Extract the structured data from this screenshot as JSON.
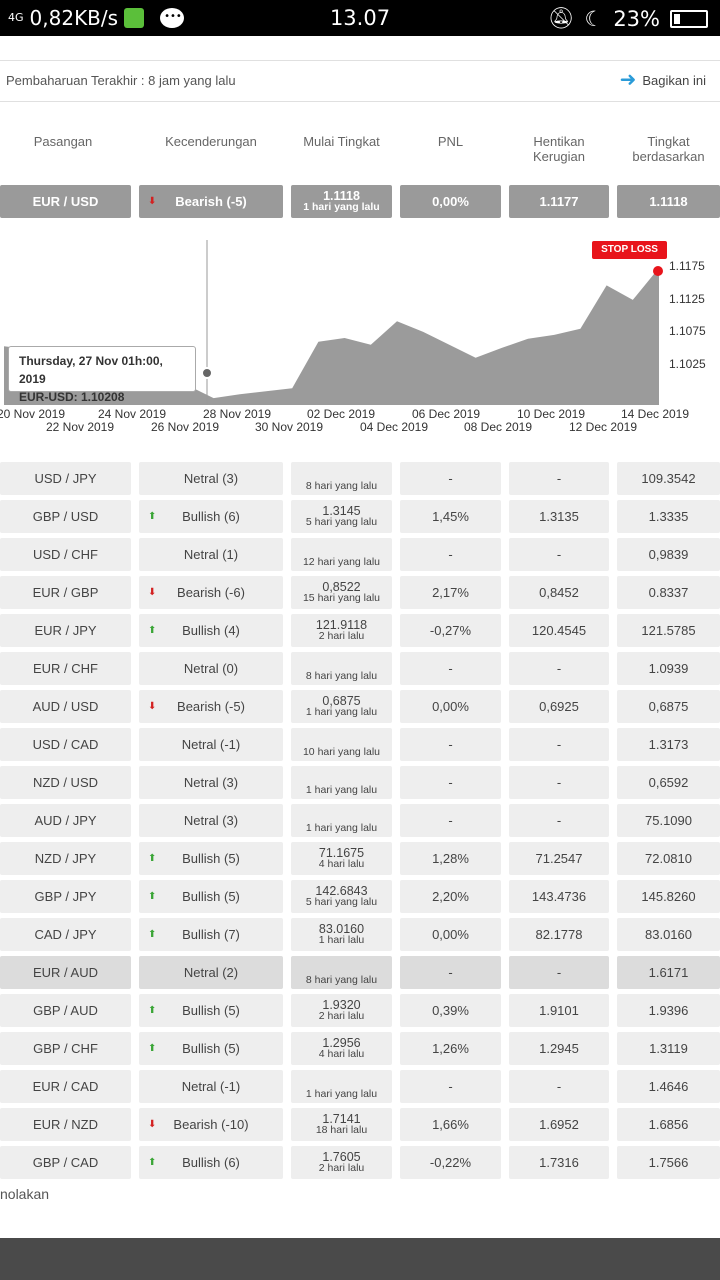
{
  "status": {
    "network": "0,82KB/s",
    "signal": "4G",
    "time": "13.07",
    "battery": "23%"
  },
  "header": {
    "updated": "Pembaharuan Terakhir : 8 jam yang lalu",
    "share": "Bagikan ini"
  },
  "columns": {
    "pair": "Pasangan",
    "trend": "Kecenderungan",
    "start": "Mulai Tingkat",
    "pnl": "PNL",
    "stop": "Hentikan Kerugian",
    "rate": "Tingkat berdasarkan"
  },
  "selected": {
    "pair": "EUR / USD",
    "trend": "Bearish (-5)",
    "trend_dir": "down",
    "level": "1.1118",
    "ago": "1 hari yang lalu",
    "pnl": "0,00%",
    "stop": "1.1177",
    "rate": "1.1118"
  },
  "chart_data": {
    "type": "area",
    "title": "",
    "series": [
      {
        "name": "EUR-USD",
        "x": [
          "2019-11-20",
          "2019-11-21",
          "2019-11-22",
          "2019-11-23",
          "2019-11-25",
          "2019-11-26",
          "2019-11-27",
          "2019-11-28",
          "2019-11-29",
          "2019-12-01",
          "2019-12-02",
          "2019-12-03",
          "2019-12-04",
          "2019-12-05",
          "2019-12-06",
          "2019-12-08",
          "2019-12-09",
          "2019-12-10",
          "2019-12-11",
          "2019-12-12",
          "2019-12-13",
          "2019-12-14",
          "2019-12-15"
        ],
        "values": [
          1.1072,
          1.1068,
          1.1058,
          1.1024,
          1.1013,
          1.1018,
          1.1021,
          1.1004,
          1.1009,
          1.1017,
          1.1078,
          1.1083,
          1.1074,
          1.1105,
          1.1091,
          1.1057,
          1.107,
          1.1082,
          1.1087,
          1.1095,
          1.1152,
          1.1133,
          1.1175
        ]
      }
    ],
    "y_ticks": [
      "1.1175",
      "1.1125",
      "1.1075",
      "1.1025"
    ],
    "x_ticks_top": [
      "20 Nov 2019",
      "24 Nov 2019",
      "28 Nov 2019",
      "02 Dec 2019",
      "06 Dec 2019",
      "10 Dec 2019",
      "14 Dec 2019"
    ],
    "x_ticks_bottom": [
      "22 Nov 2019",
      "26 Nov 2019",
      "30 Nov 2019",
      "04 Dec 2019",
      "08 Dec 2019",
      "12 Dec 2019"
    ],
    "tooltip_date": "Thursday, 27 Nov 01h:00, 2019",
    "tooltip_value": "EUR-USD: 1.10208",
    "stop_loss_label": "STOP LOSS",
    "colors": {
      "area": "#9b9b9b",
      "stop": "#e8141b"
    }
  },
  "rows": [
    {
      "pair": "USD / JPY",
      "trend": "Netral (3)",
      "dir": "",
      "level": "",
      "ago": "8 hari yang lalu",
      "pnl": "-",
      "stop": "-",
      "rate": "109.3542"
    },
    {
      "pair": "GBP / USD",
      "trend": "Bullish (6)",
      "dir": "up",
      "level": "1.3145",
      "ago": "5 hari yang lalu",
      "pnl": "1,45%",
      "stop": "1.3135",
      "rate": "1.3335"
    },
    {
      "pair": "USD / CHF",
      "trend": "Netral (1)",
      "dir": "",
      "level": "",
      "ago": "12 hari yang lalu",
      "pnl": "-",
      "stop": "-",
      "rate": "0,9839"
    },
    {
      "pair": "EUR / GBP",
      "trend": "Bearish (-6)",
      "dir": "down",
      "level": "0,8522",
      "ago": "15 hari yang lalu",
      "pnl": "2,17%",
      "stop": "0,8452",
      "rate": "0.8337"
    },
    {
      "pair": "EUR / JPY",
      "trend": "Bullish (4)",
      "dir": "up",
      "level": "121.9118",
      "ago": "2 hari lalu",
      "pnl": "-0,27%",
      "stop": "120.4545",
      "rate": "121.5785"
    },
    {
      "pair": "EUR / CHF",
      "trend": "Netral (0)",
      "dir": "",
      "level": "",
      "ago": "8 hari yang lalu",
      "pnl": "-",
      "stop": "-",
      "rate": "1.0939"
    },
    {
      "pair": "AUD / USD",
      "trend": "Bearish (-5)",
      "dir": "down",
      "level": "0,6875",
      "ago": "1 hari yang lalu",
      "pnl": "0,00%",
      "stop": "0,6925",
      "rate": "0,6875"
    },
    {
      "pair": "USD / CAD",
      "trend": "Netral (-1)",
      "dir": "",
      "level": "",
      "ago": "10 hari yang lalu",
      "pnl": "-",
      "stop": "-",
      "rate": "1.3173"
    },
    {
      "pair": "NZD / USD",
      "trend": "Netral (3)",
      "dir": "",
      "level": "",
      "ago": "1 hari yang lalu",
      "pnl": "-",
      "stop": "-",
      "rate": "0,6592"
    },
    {
      "pair": "AUD / JPY",
      "trend": "Netral (3)",
      "dir": "",
      "level": "",
      "ago": "1 hari yang lalu",
      "pnl": "-",
      "stop": "-",
      "rate": "75.1090"
    },
    {
      "pair": "NZD / JPY",
      "trend": "Bullish (5)",
      "dir": "up",
      "level": "71.1675",
      "ago": "4 hari lalu",
      "pnl": "1,28%",
      "stop": "71.2547",
      "rate": "72.0810"
    },
    {
      "pair": "GBP / JPY",
      "trend": "Bullish (5)",
      "dir": "up",
      "level": "142.6843",
      "ago": "5 hari yang lalu",
      "pnl": "2,20%",
      "stop": "143.4736",
      "rate": "145.8260"
    },
    {
      "pair": "CAD / JPY",
      "trend": "Bullish (7)",
      "dir": "up",
      "level": "83.0160",
      "ago": "1 hari lalu",
      "pnl": "0,00%",
      "stop": "82.1778",
      "rate": "83.0160"
    },
    {
      "pair": "EUR / AUD",
      "trend": "Netral (2)",
      "dir": "",
      "level": "",
      "ago": "8 hari yang lalu",
      "pnl": "-",
      "stop": "-",
      "rate": "1.6171",
      "hl": true
    },
    {
      "pair": "GBP / AUD",
      "trend": "Bullish (5)",
      "dir": "up",
      "level": "1.9320",
      "ago": "2 hari lalu",
      "pnl": "0,39%",
      "stop": "1.9101",
      "rate": "1.9396"
    },
    {
      "pair": "GBP / CHF",
      "trend": "Bullish (5)",
      "dir": "up",
      "level": "1.2956",
      "ago": "4 hari lalu",
      "pnl": "1,26%",
      "stop": "1.2945",
      "rate": "1.3119"
    },
    {
      "pair": "EUR / CAD",
      "trend": "Netral (-1)",
      "dir": "",
      "level": "",
      "ago": "1 hari yang lalu",
      "pnl": "-",
      "stop": "-",
      "rate": "1.4646"
    },
    {
      "pair": "EUR / NZD",
      "trend": "Bearish (-10)",
      "dir": "down",
      "level": "1.7141",
      "ago": "18 hari lalu",
      "pnl": "1,66%",
      "stop": "1.6952",
      "rate": "1.6856"
    },
    {
      "pair": "GBP / CAD",
      "trend": "Bullish (6)",
      "dir": "up",
      "level": "1.7605",
      "ago": "2 hari lalu",
      "pnl": "-0,22%",
      "stop": "1.7316",
      "rate": "1.7566"
    }
  ],
  "footer": {
    "text": "nolakan"
  }
}
